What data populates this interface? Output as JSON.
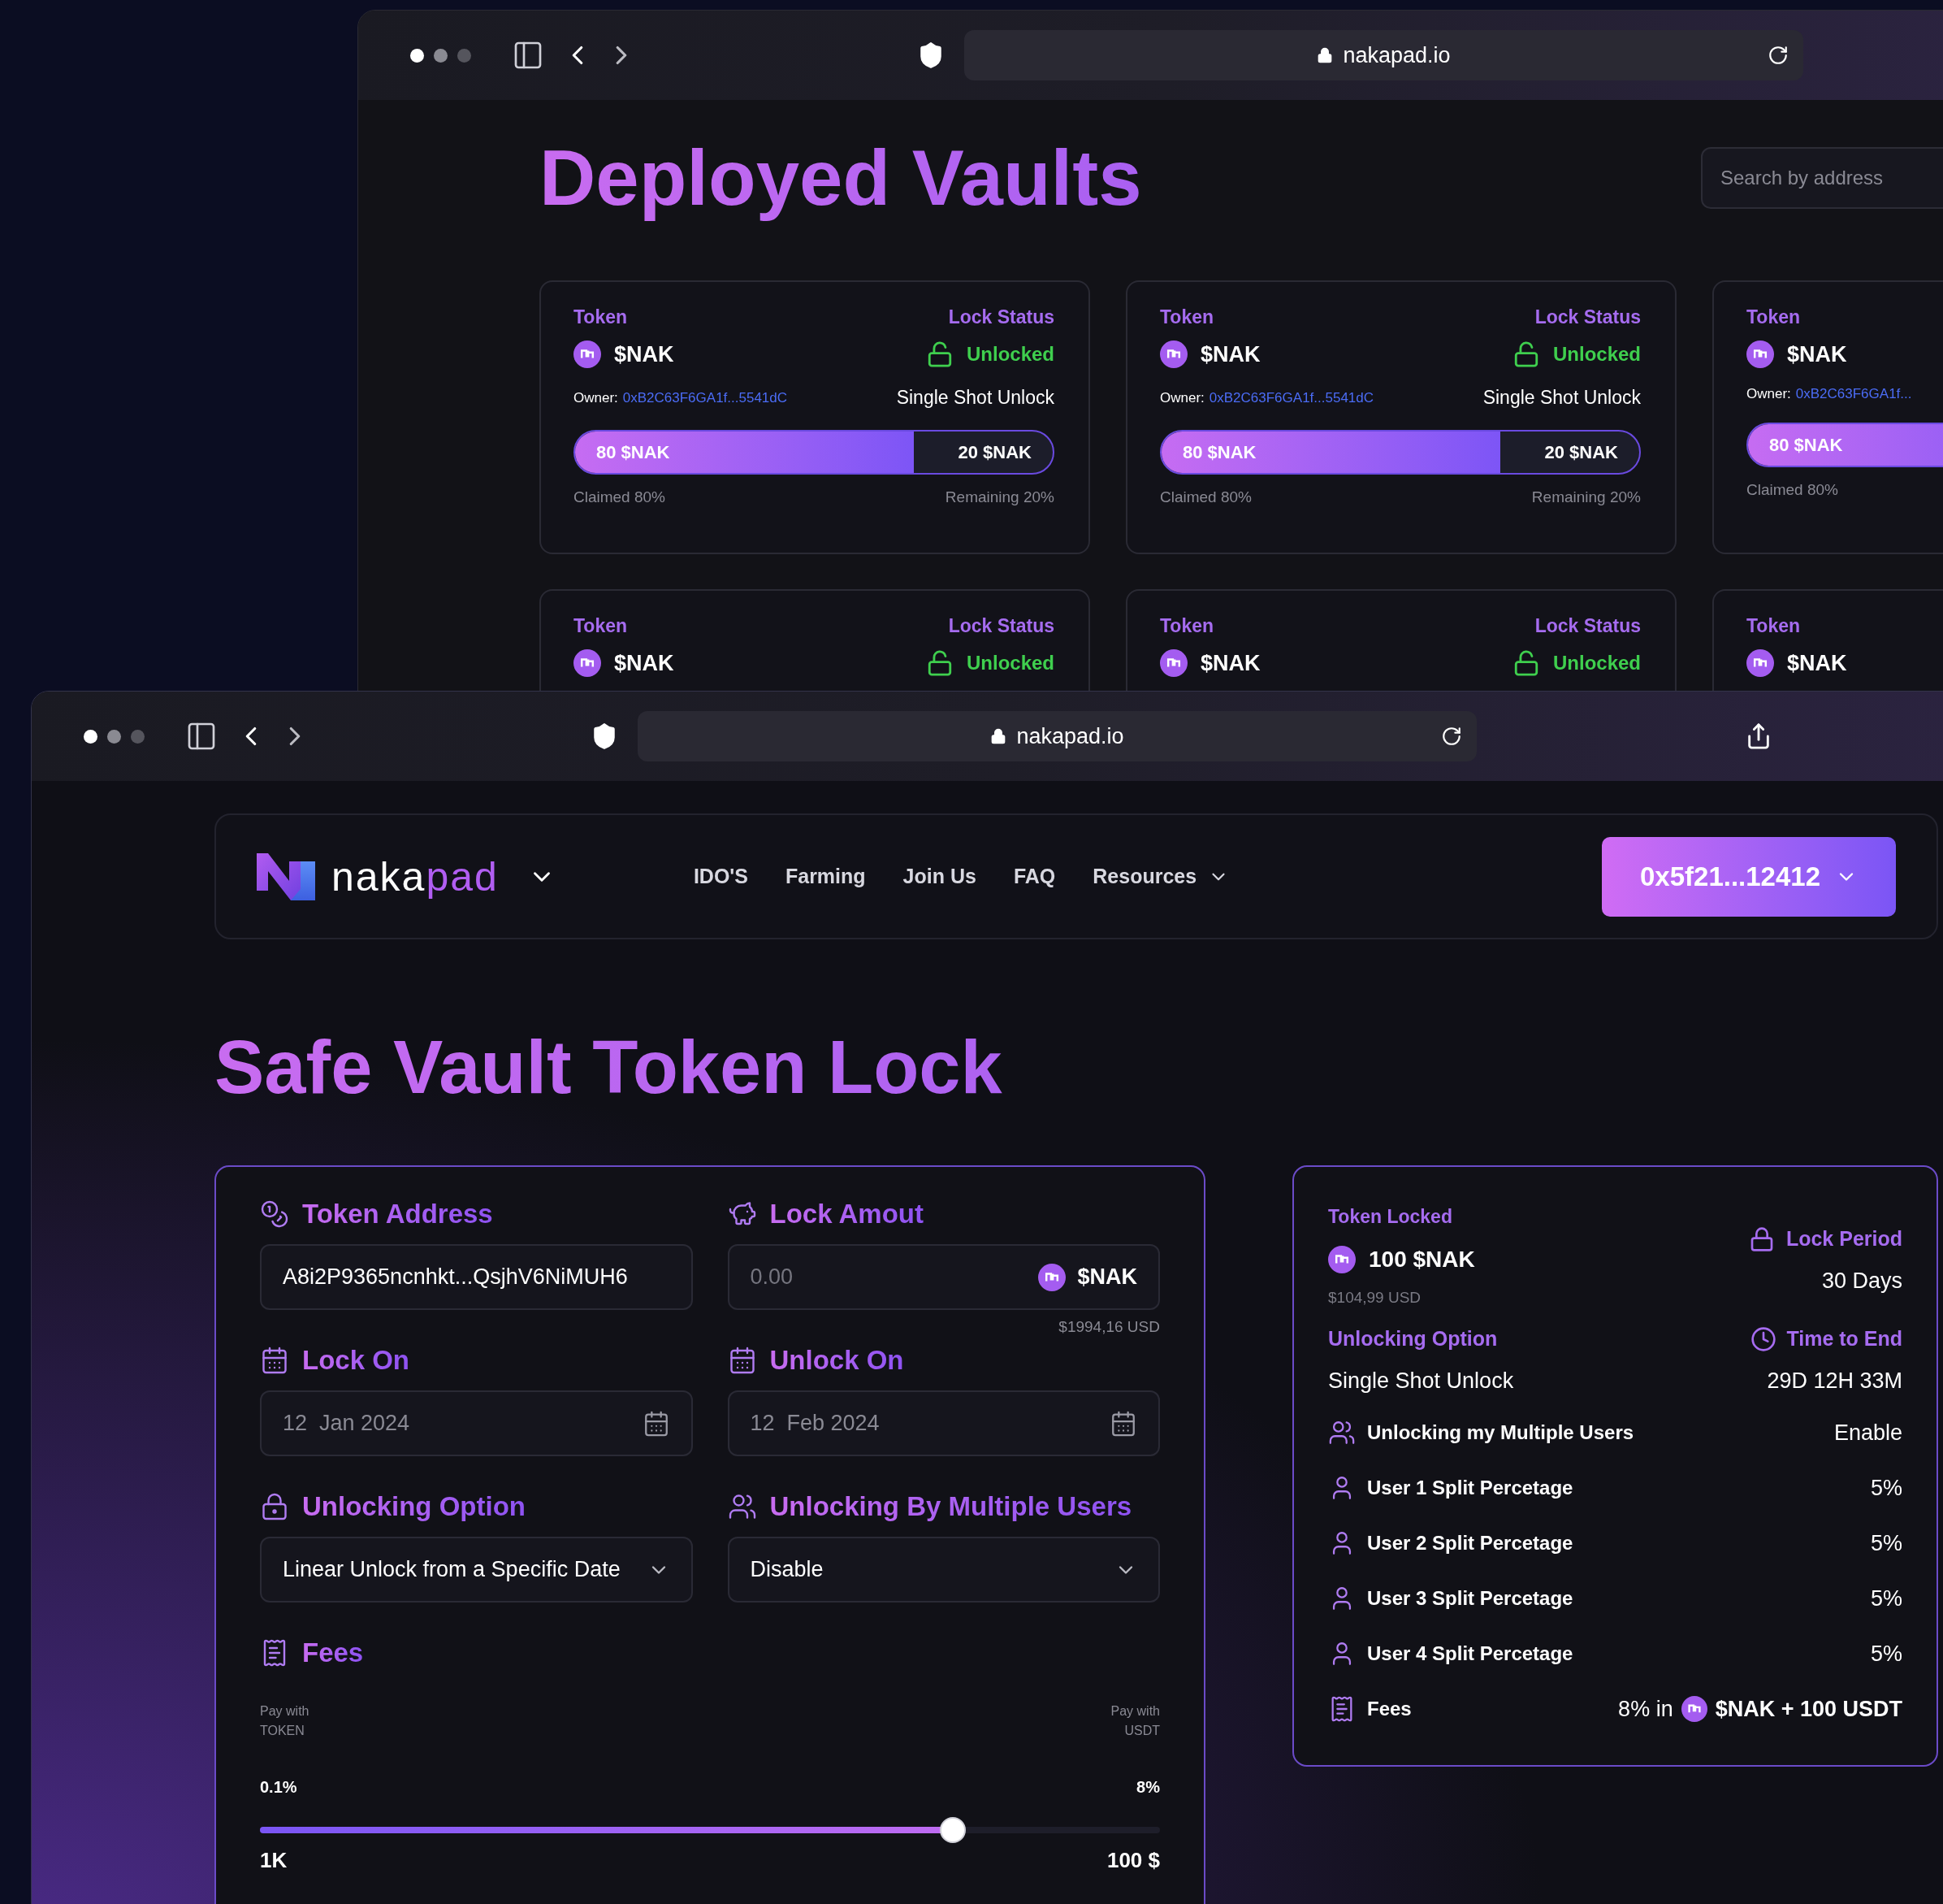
{
  "back_window": {
    "url": "nakapad.io",
    "title": "Deployed Vaults",
    "search": {
      "placeholder": "Search by address"
    },
    "vault_cards": [
      {
        "token_label": "Token",
        "token": "$NAK",
        "status_label": "Lock Status",
        "status": "Unlocked",
        "locked": false,
        "owner_label": "Owner:",
        "owner": "0xB2C63F6GA1f...5541dC",
        "unlock_type": "Single Shot Unlock",
        "claimed_amount": "80 $NAK",
        "remaining_amount": "20 $NAK",
        "level": 0.71,
        "claimed_text": "Claimed 80%",
        "remaining_text": "Remaining 20%"
      },
      {
        "token_label": "Token",
        "token": "$NAK",
        "status_label": "Lock Status",
        "status": "Unlocked",
        "locked": false,
        "owner_label": "Owner:",
        "owner": "0xB2C63F6GA1f...5541dC",
        "unlock_type": "Single Shot Unlock",
        "claimed_amount": "80 $NAK",
        "remaining_amount": "20 $NAK",
        "level": 0.71,
        "claimed_text": "Claimed 80%",
        "remaining_text": "Remaining 20%"
      },
      {
        "token_label": "Token",
        "token": "$NAK",
        "owner_label": "Owner:",
        "owner": "0xB2C63F6GA1f...",
        "claimed_amount": "80 $NAK",
        "level": 0.71,
        "claimed_text": "Claimed 80%"
      },
      {
        "token_label": "Token",
        "token": "$NAK",
        "status_label": "Lock Status",
        "status": "Unlocked",
        "locked": false
      },
      {
        "token_label": "Token",
        "token": "$NAK",
        "status_label": "Lock Status",
        "status": "Unlocked",
        "locked": false
      },
      {
        "token_label": "Token",
        "token": "$NAK"
      }
    ]
  },
  "front_window": {
    "url": "nakapad.io",
    "nav": {
      "logo": {
        "text": "naka",
        "accent": "pad"
      },
      "items": [
        {
          "label": "IDO'S",
          "has_menu": false
        },
        {
          "label": "Farming",
          "has_menu": false
        },
        {
          "label": "Join Us",
          "has_menu": false
        },
        {
          "label": "FAQ",
          "has_menu": false
        },
        {
          "label": "Resources",
          "has_menu": true
        }
      ],
      "wallet": "0x5f21...12412"
    },
    "title": "Safe Vault Token Lock",
    "form": {
      "fields": [
        {
          "kind": "address",
          "label": "Token Address",
          "value": "A8i2P9365ncnhkt...QsjhV6NiMUH6"
        },
        {
          "kind": "amount",
          "label": "Lock Amout",
          "placeholder": "0.00",
          "token": "$NAK",
          "note": "$1994,16 USD"
        },
        {
          "kind": "date",
          "label": "Lock On",
          "placeholder": "12  Jan 2024"
        },
        {
          "kind": "date",
          "label": "Unlock On",
          "placeholder": "12  Feb 2024"
        },
        {
          "kind": "option",
          "label": "Unlocking Option",
          "value": "Linear Unlock from a Specific Date"
        },
        {
          "kind": "users",
          "label": "Unlocking By Multiple Users",
          "value": "Disable"
        }
      ],
      "fees": {
        "label": "Fees",
        "left_note": "Pay with TOKEN",
        "right_note": "Pay with USDT",
        "min_label": "0.1%",
        "max_label": "8%",
        "level": 0.77,
        "min_value": "1K",
        "max_value": "100 $"
      }
    },
    "summary": {
      "token_label": "Token Locked",
      "token_amount": "100 $NAK",
      "token_usd": "$104,99 USD",
      "period_label": "Lock Period",
      "period": "30 Days",
      "option_label": "Unlocking Option",
      "option": "Single Shot Unlock",
      "time_label": "Time to End",
      "time": "29D 12H 33M",
      "rows": [
        {
          "kind": "users",
          "label": "Unlocking my Multiple Users",
          "value": "Enable"
        },
        {
          "kind": "user",
          "label": "User 1 Split Percetage",
          "value": "5%"
        },
        {
          "kind": "user",
          "label": "User 2 Split Percetage",
          "value": "5%"
        },
        {
          "kind": "user",
          "label": "User 3 Split Percetage",
          "value": "5%"
        },
        {
          "kind": "user",
          "label": "User 4 Split Percetage",
          "value": "5%"
        },
        {
          "kind": "fees",
          "label": "Fees",
          "value": "8% in",
          "value_token": "$NAK + 100 USDT"
        }
      ]
    }
  }
}
